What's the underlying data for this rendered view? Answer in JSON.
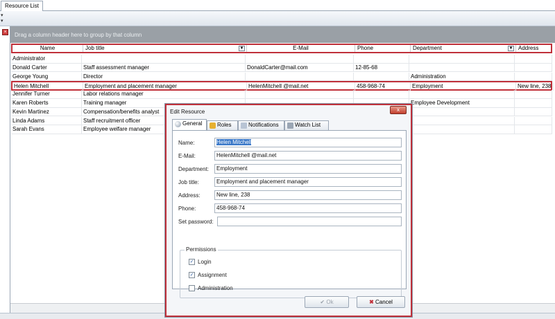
{
  "tab": {
    "label": "Resource List"
  },
  "group_panel": {
    "text": "Drag a column header here to group by that column"
  },
  "grid": {
    "columns": [
      "Name",
      "Job title",
      "E-Mail",
      "Phone",
      "Department",
      "Address"
    ],
    "rows": [
      [
        "Administrator",
        "",
        "",
        "",
        "",
        ""
      ],
      [
        "Donald Carter",
        "Staff assessment manager",
        "DonaldCarter@mail.com",
        "12-85-68",
        "",
        ""
      ],
      [
        "George Young",
        "Director",
        "",
        "",
        "Administration",
        ""
      ],
      [
        "Helen Mitchell",
        "Employment and placement manager",
        "HelenMitchell @mail.net",
        "458-968-74",
        "Employment",
        "New line, 238"
      ],
      [
        "Jennifer Turner",
        "Labor relations manager",
        "",
        "",
        "",
        ""
      ],
      [
        "Karen Roberts",
        "Training manager",
        "",
        "",
        "Employee Development",
        ""
      ],
      [
        "Kevin Martinez",
        "Compensation/benefits analyst",
        "",
        "",
        "",
        ""
      ],
      [
        "Linda  Adams",
        "Staff recruitment officer",
        "",
        "",
        "",
        ""
      ],
      [
        "Sarah Evans",
        "Employee welfare manager",
        "",
        "",
        "",
        ""
      ]
    ]
  },
  "dialog": {
    "title": "Edit Resource",
    "close_glyph": "x",
    "tabs": [
      "General",
      "Roles",
      "Notifications",
      "Watch List"
    ],
    "fields": {
      "name_label": "Name:",
      "name_value": "Helen Mitchell",
      "email_label": "E-Mail:",
      "email_value": "HelenMitchell @mail.net",
      "department_label": "Department:",
      "department_value": "Employment",
      "jobtitle_label": "Job title:",
      "jobtitle_value": "Employment and placement manager",
      "address_label": "Address:",
      "address_value": "New line, 238",
      "phone_label": "Phone:",
      "phone_value": "458-968-74",
      "password_label": "Set password:",
      "password_value": ""
    },
    "permissions": {
      "legend": "Permissions",
      "items": [
        {
          "label": "Login",
          "checked": true
        },
        {
          "label": "Assignment",
          "checked": true
        },
        {
          "label": "Administration",
          "checked": false
        }
      ]
    },
    "ok_label": "Ok",
    "cancel_label": "Cancel"
  },
  "colors": {
    "highlight": "#c0303a",
    "selection": "#3a78c8",
    "group_panel": "#9aa0a6"
  }
}
